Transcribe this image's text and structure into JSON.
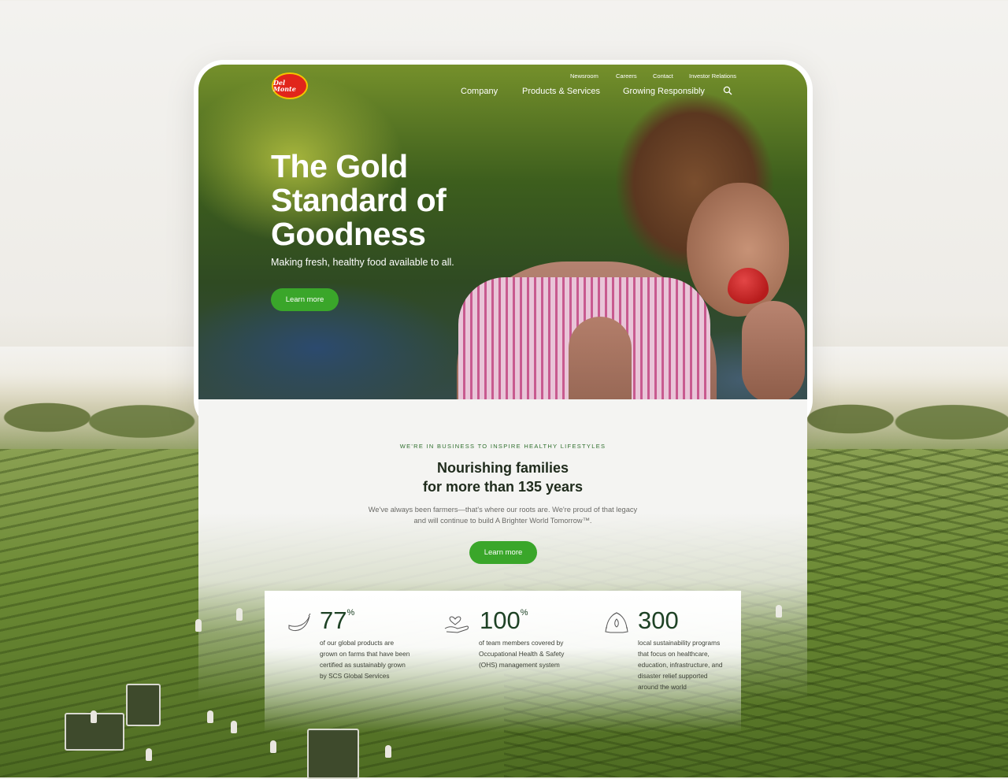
{
  "brand": {
    "logo_text": "Del Monte",
    "accent_green": "#3aa62a",
    "logo_red": "#e1251b"
  },
  "utility_nav": [
    "Newsroom",
    "Careers",
    "Contact",
    "Investor Relations"
  ],
  "main_nav": [
    "Company",
    "Products & Services",
    "Growing Responsibly"
  ],
  "hero": {
    "title_line1": "The Gold",
    "title_line2": "Standard of",
    "title_line3": "Goodness",
    "subtitle": "Making fresh, healthy food available to all.",
    "cta": "Learn more"
  },
  "intro": {
    "eyebrow": "WE'RE IN BUSINESS TO INSPIRE HEALTHY LIFESTYLES",
    "heading_line1": "Nourishing families",
    "heading_line2": "for more than 135 years",
    "body": "We've always been farmers—that's where our roots are. We're proud of that legacy and will continue to build A Brighter World Tomorrow™.",
    "cta": "Learn more"
  },
  "stats": [
    {
      "icon": "banana-icon",
      "value": "77",
      "unit": "%",
      "desc": "of our global products are grown on farms that have been certified as sustainably grown by SCS Global Services"
    },
    {
      "icon": "hand-heart-icon",
      "value": "100",
      "unit": "%",
      "desc": "of team members covered by Occupational Health & Safety (OHS) management system"
    },
    {
      "icon": "recycle-leaf-icon",
      "value": "300",
      "unit": "",
      "desc": "local sustainability programs that focus on healthcare, education, infrastructure, and disaster relief supported around the world"
    }
  ]
}
